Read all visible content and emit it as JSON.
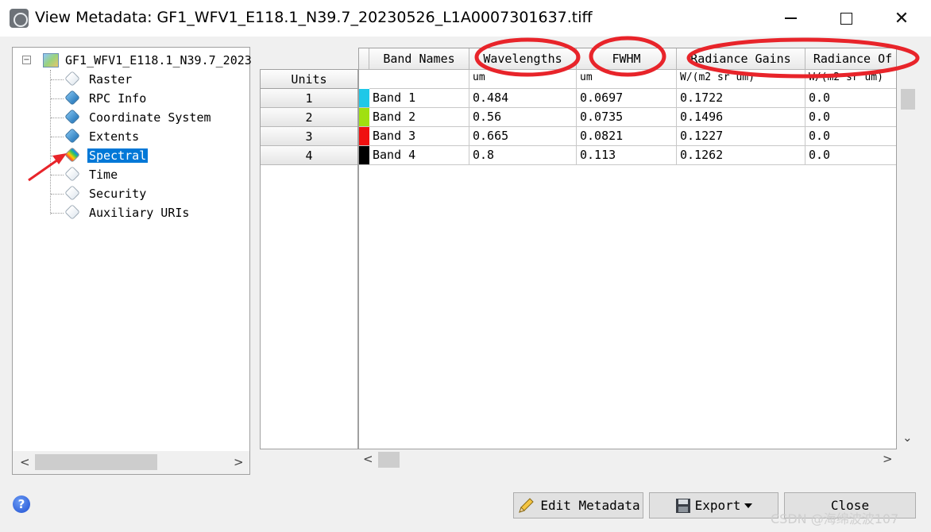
{
  "window": {
    "title": "View Metadata: GF1_WFV1_E118.1_N39.7_20230526_L1A0007301637.tiff",
    "minimize_glyph": "",
    "close_glyph": "✕"
  },
  "tree": {
    "root_label": "GF1_WFV1_E118.1_N39.7_2023",
    "expander": "−",
    "items": [
      {
        "label": "Raster",
        "icon": "tag-icon-white"
      },
      {
        "label": "RPC Info",
        "icon": "tag-icon-blue"
      },
      {
        "label": "Coordinate System",
        "icon": "tag-icon-blue"
      },
      {
        "label": "Extents",
        "icon": "tag-icon-blue"
      },
      {
        "label": "Spectral",
        "icon": "spectral-icon",
        "selected": true
      },
      {
        "label": "Time",
        "icon": "tag-icon-white"
      },
      {
        "label": "Security",
        "icon": "tag-icon-white"
      },
      {
        "label": "Auxiliary URIs",
        "icon": "tag-icon-white"
      }
    ],
    "scroll_left": "<",
    "scroll_right": ">"
  },
  "table": {
    "units_header": "Units",
    "columns": [
      "Band Names",
      "Wavelengths",
      "FWHM",
      "Radiance Gains",
      "Radiance Of"
    ],
    "units": [
      "",
      "um",
      "um",
      "W/(m2 sr um)",
      "W/(m2 sr um)"
    ],
    "rows": [
      {
        "index": "1",
        "color": "#1ec8e8",
        "name": "Band 1",
        "wavelength": "0.484",
        "fwhm": "0.0697",
        "gain": "0.1722",
        "offset": "0.0"
      },
      {
        "index": "2",
        "color": "#a0e010",
        "name": "Band 2",
        "wavelength": "0.56",
        "fwhm": "0.0735",
        "gain": "0.1496",
        "offset": "0.0"
      },
      {
        "index": "3",
        "color": "#f01010",
        "name": "Band 3",
        "wavelength": "0.665",
        "fwhm": "0.0821",
        "gain": "0.1227",
        "offset": "0.0"
      },
      {
        "index": "4",
        "color": "#000000",
        "name": "Band 4",
        "wavelength": "0.8",
        "fwhm": "0.113",
        "gain": "0.1262",
        "offset": "0.0"
      }
    ],
    "scroll_down": "⌄",
    "scroll_left": "<",
    "scroll_right": ">"
  },
  "buttons": {
    "edit": "Edit Metadata",
    "export": "Export",
    "close": "Close"
  },
  "help_glyph": "?",
  "watermark": "CSDN @海绵波波107",
  "annotation_color": "#e8242a"
}
